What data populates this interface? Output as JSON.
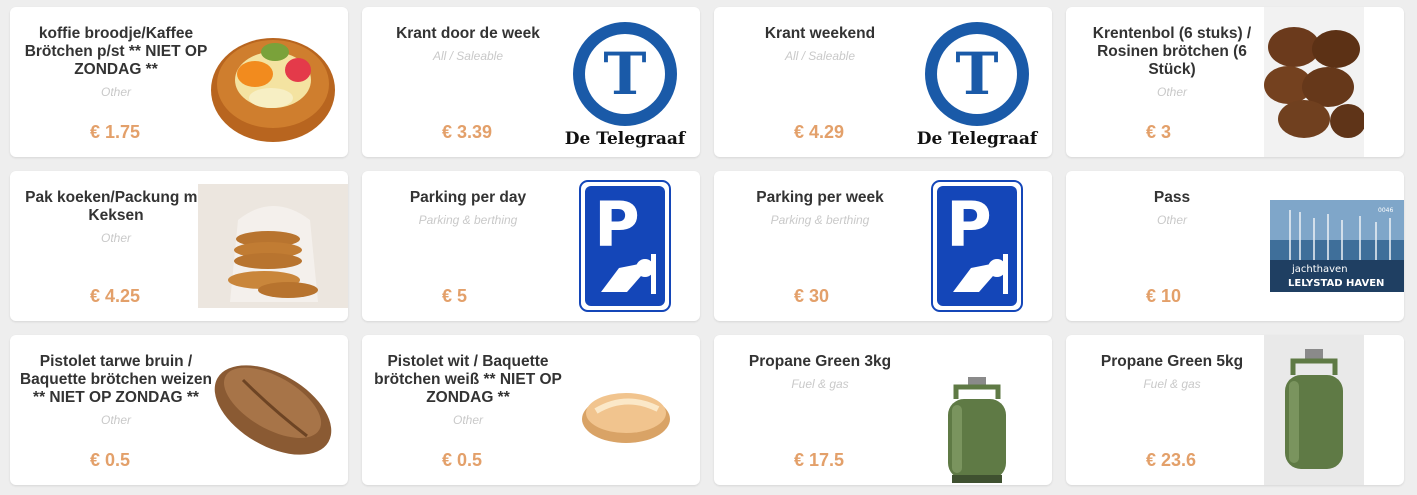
{
  "products": [
    {
      "name": "koffie broodje/Kaffee Brötchen p/st ** NIET OP ZONDAG **",
      "category": "Other",
      "price": "€ 1.75",
      "image": "fruit-pastry-image"
    },
    {
      "name": "Krant door de week",
      "category": "All / Saleable",
      "price": "€ 3.39",
      "image": "telegraaf-logo",
      "logo_text": "De Telegraaf"
    },
    {
      "name": "Krant weekend",
      "category": "All / Saleable",
      "price": "€ 4.29",
      "image": "telegraaf-logo",
      "logo_text": "De Telegraaf"
    },
    {
      "name": "Krentenbol (6 stuks) / Rosinen brötchen (6 Stück)",
      "category": "Other",
      "price": "€ 3",
      "image": "currant-buns-image"
    },
    {
      "name": "Pak koeken/Packung mit Keksen",
      "category": "Other",
      "price": "€ 4.25",
      "image": "stroopwafel-pack-image"
    },
    {
      "name": "Parking per day",
      "category": "Parking & berthing",
      "price": "€ 5",
      "image": "parking-sign-icon"
    },
    {
      "name": "Parking per week",
      "category": "Parking & berthing",
      "price": "€ 30",
      "image": "parking-sign-icon"
    },
    {
      "name": "Pass",
      "category": "Other",
      "price": "€ 10",
      "image": "harbour-pass-image",
      "pass_text": {
        "line1": "jachthaven",
        "line2": "LELYSTAD HAVEN",
        "number": "0046"
      }
    },
    {
      "name": "Pistolet tarwe bruin / Baquette brötchen weizen ** NIET OP ZONDAG **",
      "category": "Other",
      "price": "€ 0.5",
      "image": "brown-roll-image"
    },
    {
      "name": "Pistolet wit / Baquette brötchen weiß ** NIET OP ZONDAG **",
      "category": "Other",
      "price": "€ 0.5",
      "image": "white-roll-image"
    },
    {
      "name": "Propane Green 3kg",
      "category": "Fuel & gas",
      "price": "€ 17.5",
      "image": "gas-bottle-image"
    },
    {
      "name": "Propane Green 5kg",
      "category": "Fuel & gas",
      "price": "€ 23.6",
      "image": "gas-bottle-image"
    }
  ],
  "colors": {
    "price": "#e3a06a",
    "category": "#c9c9c9",
    "telegraaf_blue": "#1a5aa8",
    "parking_blue": "#1446b8",
    "gas_green": "#5f7a45"
  }
}
